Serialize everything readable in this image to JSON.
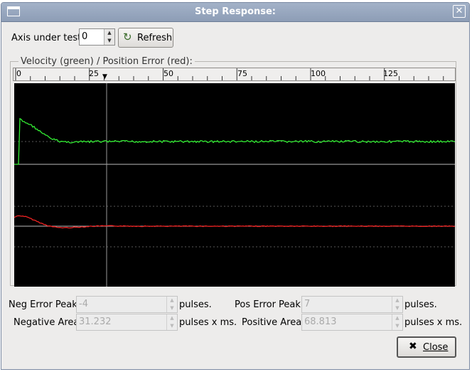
{
  "window": {
    "title": "Step Response:"
  },
  "axis": {
    "label": "Axis under test:",
    "value": "0"
  },
  "refresh": {
    "label": "Refresh"
  },
  "graph": {
    "title": "Velocity (green) / Position Error (red):",
    "ruler_ticks": [
      "0",
      "25",
      "50",
      "75",
      "100",
      "125"
    ],
    "colors": {
      "velocity": "#33ee33",
      "position_error": "#ee2222",
      "background": "#000000"
    }
  },
  "stats": {
    "neg_error_peak": {
      "label": "Neg Error Peak:",
      "value": "-4",
      "unit": "pulses."
    },
    "pos_error_peak": {
      "label": "Pos Error Peak:",
      "value": "7",
      "unit": "pulses."
    },
    "negative_area": {
      "label": "Negative Area:",
      "value": "31.232",
      "unit": "pulses x ms."
    },
    "positive_area": {
      "label": "Positive Area:",
      "value": "68.813",
      "unit": "pulses x ms."
    }
  },
  "close": {
    "label": "Close"
  }
}
